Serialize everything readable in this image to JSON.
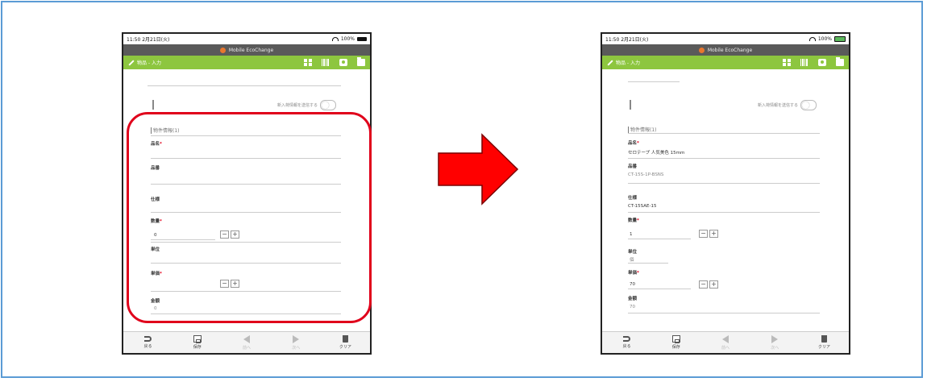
{
  "colors": {
    "frame_border": "#5b9bd5",
    "toolbar_green": "#8dc63f",
    "titlebar_gray": "#5a5a5a",
    "highlight_red": "#e0001b",
    "arrow_red": "#ff0000",
    "required_red": "#e0001b"
  },
  "left": {
    "status": {
      "time": "11:50",
      "carrier": "2月21日(火)",
      "battery": "100%"
    },
    "app_title": "Mobile EcoChange",
    "toolbar": {
      "mode_label": "物品 - 入力",
      "icons": [
        "qr-code-icon",
        "barcode-icon",
        "camera-icon",
        "folder-icon"
      ]
    },
    "toggle_label": "新入荷情報を送信する",
    "section_title": "物件情報(1)",
    "fields": {
      "name_label": "品名",
      "model_label": "品番",
      "spec_label": "仕様",
      "qty_label": "数量",
      "qty_value": "0",
      "unit_label": "単位",
      "price_label": "単価",
      "amount_label": "金額",
      "amount_value": "0"
    },
    "stepper": {
      "minus": "−",
      "plus": "+"
    },
    "bottom": {
      "back": "戻る",
      "save": "保存",
      "prev": "前へ",
      "next": "次へ",
      "clear": "クリア"
    }
  },
  "right": {
    "status": {
      "time": "11:50",
      "carrier": "2月21日(火)",
      "battery": "100%"
    },
    "app_title": "Mobile EcoChange",
    "toolbar": {
      "mode_label": "物品 - 入力",
      "icons": [
        "qr-code-icon",
        "barcode-icon",
        "camera-icon",
        "folder-icon"
      ]
    },
    "toggle_label": "新入荷情報を送信する",
    "section_title": "物件情報(1)",
    "fields": {
      "name_label": "品名",
      "name_value": "セロテープ 人気美色 15mm",
      "model_label": "品番",
      "model_value": "CT-15S-1P-BSNS",
      "spec_label": "仕様",
      "spec_value": "CT-15SAE-15",
      "qty_label": "数量",
      "qty_value": "1",
      "unit_label": "単位",
      "unit_value": "個",
      "price_label": "単価",
      "price_value": "70",
      "amount_label": "金額",
      "amount_value": "70"
    },
    "stepper": {
      "minus": "−",
      "plus": "+"
    },
    "bottom": {
      "back": "戻る",
      "save": "保存",
      "prev": "前へ",
      "next": "次へ",
      "clear": "クリア"
    }
  }
}
